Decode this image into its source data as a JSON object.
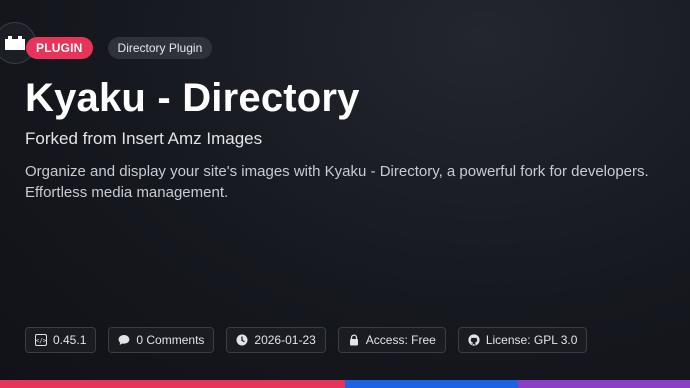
{
  "header": {
    "badge_plugin": "PLUGIN",
    "badge_type": "Directory Plugin"
  },
  "main": {
    "title": "Kyaku - Directory",
    "subtitle": "Forked from Insert Amz Images",
    "description": "Organize and display your site's images with Kyaku - Directory, a powerful fork for developers. Effortless media management."
  },
  "meta": {
    "version": "0.45.1",
    "comments": "0 Comments",
    "date": "2026-01-23",
    "access": "Access: Free",
    "license": "License: GPL 3.0"
  },
  "icons": {
    "plugin": "plugin-icon",
    "version": "code-icon",
    "comments": "comment-bubble-icon",
    "date": "clock-icon",
    "access": "lock-icon",
    "license": "github-icon"
  },
  "colors": {
    "accent": "#e8335b",
    "background": "#16181f",
    "bar": [
      "#e8335b",
      "#e8335b",
      "#1d63e6",
      "#8a3fc6"
    ]
  }
}
